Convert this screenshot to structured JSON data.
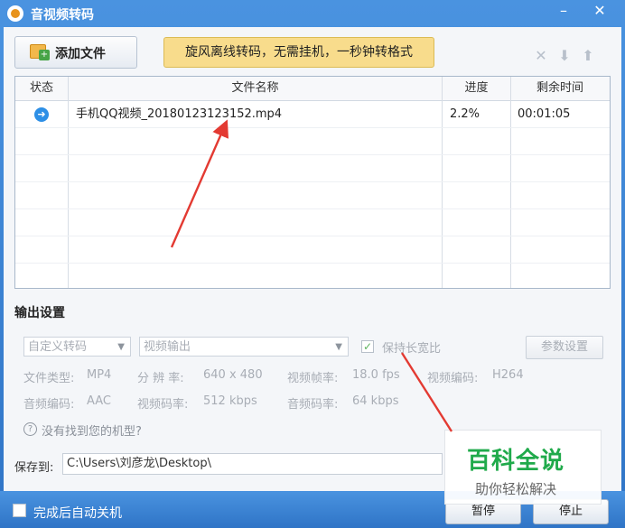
{
  "window": {
    "title": "音视频转码",
    "minimize_symbol": "–",
    "close_symbol": "✕",
    "icon": "app-icon"
  },
  "toolbar": {
    "add_file_label": "添加文件",
    "promo_text": "旋风离线转码，无需挂机，一秒钟转格式",
    "delete_icon": "delete-icon",
    "move_down_icon": "move-down-icon",
    "move_up_icon": "move-up-icon"
  },
  "table": {
    "headers": [
      "状态",
      "文件名称",
      "进度",
      "剩余时间"
    ],
    "rows": [
      {
        "status_icon": "play-arrow-icon",
        "filename": "手机QQ视频_20180123123152.mp4",
        "progress": "2.2%",
        "remaining": "00:01:05"
      }
    ]
  },
  "output_settings": {
    "section_title": "输出设置",
    "profile_value": "自定义转码",
    "output_type_value": "视频输出",
    "keep_ratio_label": "保持长宽比",
    "keep_ratio_checked": true,
    "param_button_label": "参数设置",
    "file_type_label": "文件类型:",
    "file_type_value": "MP4",
    "resolution_label": "分 辨 率:",
    "resolution_value": "640 x 480",
    "framerate_label": "视频帧率:",
    "framerate_value": "18.0 fps",
    "video_codec_label": "视频编码:",
    "video_codec_value": "H264",
    "audio_codec_label": "音频编码:",
    "audio_codec_value": "AAC",
    "video_bitrate_label": "视频码率:",
    "video_bitrate_value": "512 kbps",
    "audio_bitrate_label": "音频码率:",
    "audio_bitrate_value": "64 kbps",
    "help_link": "没有找到您的机型?"
  },
  "save": {
    "label": "保存到:",
    "path": "C:\\Users\\刘彦龙\\Desktop\\"
  },
  "bottom": {
    "auto_shutdown_label": "完成后自动关机",
    "pause_label": "暂停",
    "stop_label": "停止"
  },
  "watermark": {
    "title": "百科全说",
    "subtitle": "助你轻松解决"
  },
  "colors": {
    "title_bar": "#3f86d6",
    "promo_bg": "#f8dc8c",
    "watermark_green": "#20aa4b",
    "annotation_arrow": "#e33a32"
  }
}
